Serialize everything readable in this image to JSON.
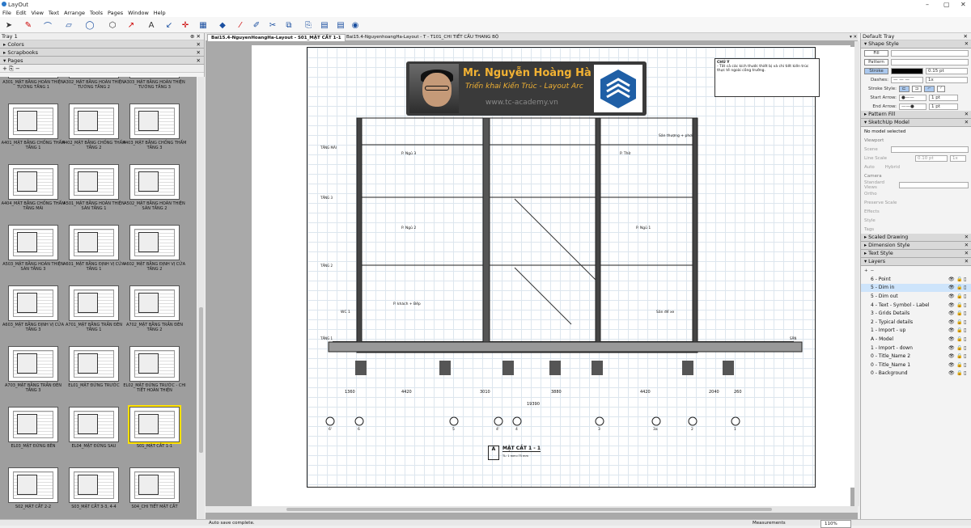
{
  "app": {
    "title": "LayOut"
  },
  "menu": [
    "File",
    "Edit",
    "View",
    "Text",
    "Arrange",
    "Tools",
    "Pages",
    "Window",
    "Help"
  ],
  "left_tray": {
    "title": "Tray 1",
    "sections": [
      "Colors",
      "Scrapbooks",
      "Pages"
    ],
    "pages": [
      "A301_MẶT BẰNG HOÀN THIỆN TƯỜNG TẦNG 1",
      "A302_MẶT BẰNG HOÀN THIỆN TƯỜNG TẦNG 2",
      "A303_MẶT BẰNG HOÀN THIỆN TƯỜNG TẦNG 3",
      "A401_MẶT BẰNG CHỐNG THẤM TẦNG 1",
      "A402_MẶT BẰNG CHỐNG THẤM TẦNG 2",
      "A403_MẶT BẰNG CHỐNG THẤM TẦNG 3",
      "A404_MẶT BẰNG CHỐNG THẤM TẦNG MÁI",
      "A501_MẶT BẰNG HOÀN THIỆN SÀN TẦNG 1",
      "A502_MẶT BẰNG HOÀN THIỆN SÀN TẦNG 2",
      "A503_MẶT BẰNG HOÀN THIỆN SÀN TẦNG 3",
      "A601_MẶT BẰNG ĐỊNH VỊ CỬA TẦNG 1",
      "A602_MẶT BẰNG ĐỊNH VỊ CỬA TẦNG 2",
      "A603_MẶT BẰNG ĐỊNH VỊ CỬA TẦNG 3",
      "A701_MẶT BẰNG TRẦN ĐÈN TẦNG 1",
      "A702_MẶT BẰNG TRẦN ĐÈN TẦNG 2",
      "A703_MẶT BẰNG TRẦN ĐÈN TẦNG 3",
      "EL01_MẶT ĐỨNG TRƯỚC",
      "EL02_MẶT ĐỨNG TRƯỚC - CHI TIẾT HOÀN THIỆN",
      "EL03_MẶT ĐỨNG BÊN",
      "EL04_MẶT ĐỨNG SAU",
      "S01_MẶT CẮT 1-1",
      "S02_MẶT CẮT 2-2",
      "S03_MẶT CẮT 3-3, 4-4",
      "S04_CHI TIẾT MẶT CẮT"
    ],
    "selected_page": "S01_MẶT CẮT 1-1"
  },
  "tabs": [
    {
      "label": "Bai15.4-NguyenHoangHa-Layout - S01_MẶT CẮT 1-1",
      "active": true
    },
    {
      "label": "Bai15.4-NguyenhoangHa-Layout - T - T101_CHI TIẾT CẦU THANG BỘ",
      "active": false
    }
  ],
  "banner": {
    "name": "Mr. Nguyễn Hoàng Hà",
    "subtitle": "Triển khai Kiến Trúc - Layout Arc",
    "website": "www.tc-academy.vn"
  },
  "drawing": {
    "note_title": "CHÚ Ý",
    "note_text": "- Tất cả các kích thước thiết bị và chi tiết kiến trúc thực tế ngoài công trường.",
    "section_title": "MẶT CẮT 1 - 1",
    "section_id": "A",
    "scale": "TL: 1 mm=75 mm",
    "total_dim": "19390",
    "dims": [
      "1360",
      "4420",
      "3010",
      "3880",
      "4420",
      "2040",
      "260"
    ],
    "axes": [
      "6'",
      "6",
      "5",
      "4'",
      "4",
      "3",
      "3a",
      "2",
      "1"
    ],
    "rooms": [
      "P. Ngủ 3",
      "P. Ngủ 2",
      "P. Thờ",
      "P. Ngủ 1",
      "P. khách + Bếp",
      "Sân để xe",
      "Sân thượng + phơi",
      "WC 1"
    ],
    "levels": [
      "TẦNG MÁI",
      "TẦNG 3",
      "TẦNG 2",
      "TẦNG 1",
      "SÂN"
    ]
  },
  "right_tray": {
    "title": "Default Tray",
    "shape_style": {
      "title": "Shape Style",
      "fill": "Fill",
      "pattern": "Pattern",
      "stroke": "Stroke",
      "stroke_width": "0.15 pt",
      "dashes": "Dashes:",
      "dash_scale": "1x",
      "stroke_style": "Stroke Style:",
      "start_arrow": "Start Arrow:",
      "end_arrow": "End Arrow:",
      "start_size": "1 pt",
      "end_size": "1 pt"
    },
    "pattern_fill": "Pattern Fill",
    "sketchup_model": {
      "title": "SketchUp Model",
      "status": "No model selected",
      "viewport": "Viewport",
      "scene": "Scene",
      "line_scale": "Line Scale",
      "line_scale_value": "0.10 pt",
      "line_mult": "1x",
      "auto": "Auto",
      "hybrid": "Hybrid",
      "camera": "Camera",
      "standard_views": "Standard Views",
      "ortho": "Ortho",
      "preserve_scale": "Preserve Scale",
      "effects": "Effects",
      "style": "Style",
      "tags": "Tags"
    },
    "sections": [
      "Scaled Drawing",
      "Dimension Style",
      "Text Style"
    ],
    "layers": {
      "title": "Layers",
      "items": [
        "6 - Point",
        "5 - Dim in",
        "5 - Dim out",
        "4 - Text - Symbol - Label",
        "3 - Grids Details",
        "2 - Typical details",
        "1 - Import - up",
        "A - Model",
        "1 - Import - down",
        "0 - Title_Name 2",
        "0 - Title_Name 1",
        "0 - Background"
      ],
      "selected": "5 - Dim in"
    }
  },
  "status": {
    "left": "Auto save complete.",
    "measurements": "Measurements",
    "zoom": "110%"
  }
}
